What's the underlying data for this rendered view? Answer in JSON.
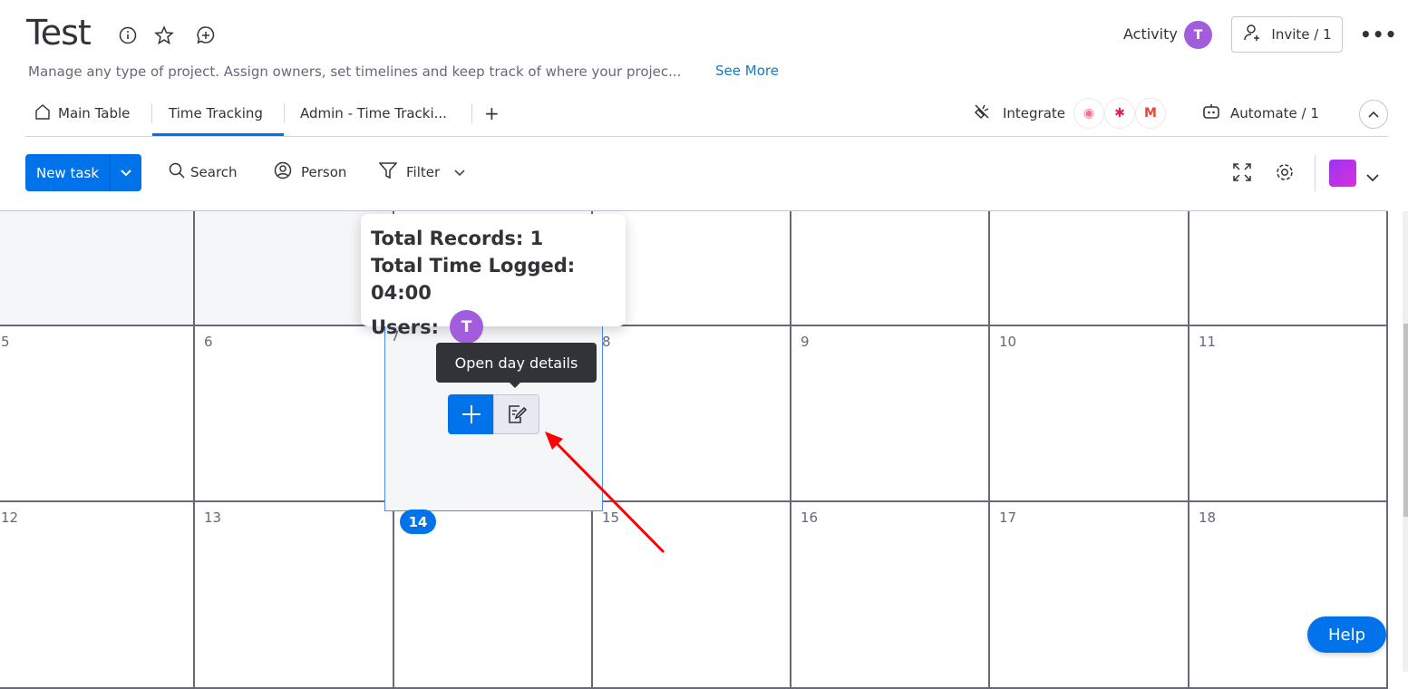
{
  "header": {
    "title": "Test",
    "description": "Manage any type of project. Assign owners, set timelines and keep track of where your projec...",
    "see_more": "See More",
    "activity": "Activity",
    "activity_avatar": "T",
    "invite": "Invite / 1"
  },
  "tabs": [
    {
      "label": "Main Table"
    },
    {
      "label": "Time Tracking",
      "active": true
    },
    {
      "label": "Admin - Time Tracki..."
    }
  ],
  "tab_add": "+",
  "integrations": {
    "integrate": "Integrate",
    "automate": "Automate / 1"
  },
  "toolbar": {
    "new_task": "New task",
    "search": "Search",
    "person": "Person",
    "filter": "Filter"
  },
  "calendar": {
    "weeks": [
      [
        "",
        "",
        "",
        "",
        "",
        "",
        ""
      ],
      [
        "5",
        "6",
        "7",
        "8",
        "9",
        "10",
        "11"
      ],
      [
        "12",
        "13",
        "14",
        "15",
        "16",
        "17",
        "18"
      ]
    ],
    "today": "14"
  },
  "popup": {
    "records": "Total Records: 1",
    "time": "Total Time Logged: 04:00",
    "users": "Users:",
    "user_avatar": "T"
  },
  "tooltip": "Open day details",
  "help": "Help",
  "colors": {
    "accent": "#0073ea",
    "avatar": "#a25ddc",
    "annotation": "#ff0000"
  }
}
